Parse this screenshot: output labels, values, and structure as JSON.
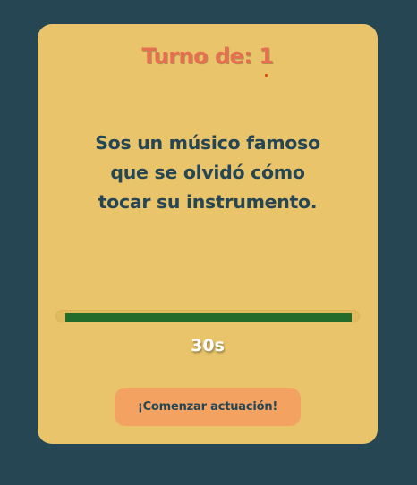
{
  "turn": {
    "title": "Turno de: 1"
  },
  "prompt": {
    "text": "Sos un músico famoso que se olvidó cómo tocar su instrumento."
  },
  "timer": {
    "progress_percent": 100,
    "label": "30s"
  },
  "actions": {
    "start_label": "¡Comenzar actuación!"
  },
  "colors": {
    "background": "#264653",
    "card": "#e9c46a",
    "title": "#e76f51",
    "prompt_text": "#264653",
    "progress_fill": "#226b2a",
    "button": "#f4a261"
  }
}
